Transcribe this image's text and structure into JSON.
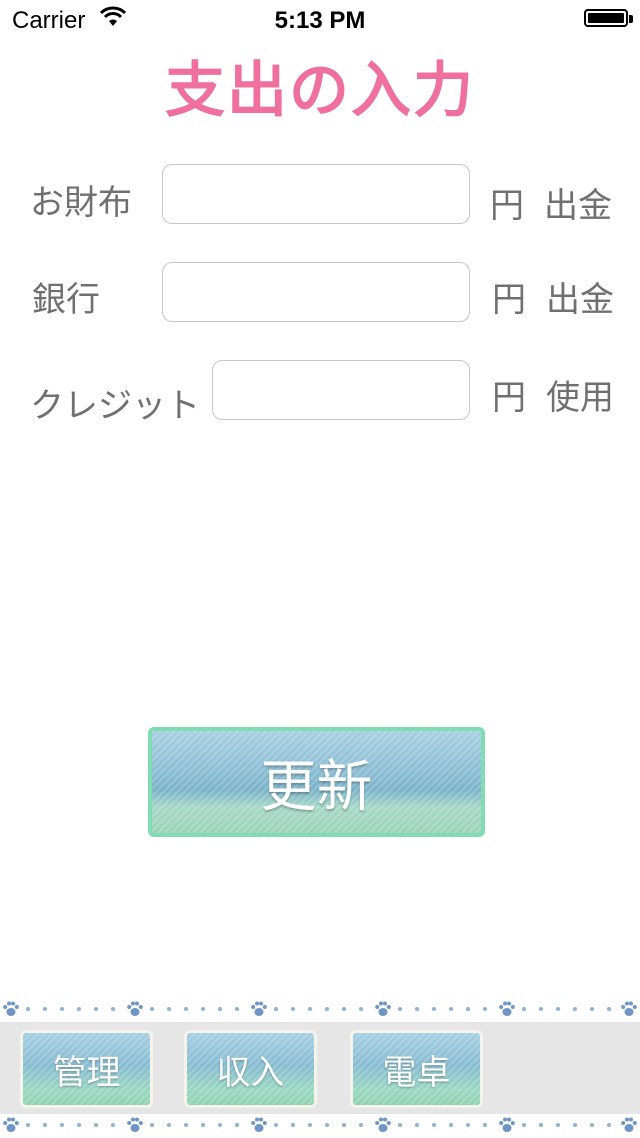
{
  "status_bar": {
    "carrier": "Carrier",
    "time": "5:13 PM"
  },
  "title": "支出の入力",
  "rows": [
    {
      "label": "お財布",
      "unit": "円",
      "action": "出金",
      "value": ""
    },
    {
      "label": "銀行",
      "unit": "円",
      "action": "出金",
      "value": ""
    },
    {
      "label": "クレジット",
      "unit": "円",
      "action": "使用",
      "value": ""
    }
  ],
  "update_button": "更新",
  "tabs": [
    "管理",
    "収入",
    "電卓"
  ],
  "colors": {
    "title": "#ef6f9f",
    "button_border": "#7fdcb3",
    "paw": "#6f95c4"
  }
}
